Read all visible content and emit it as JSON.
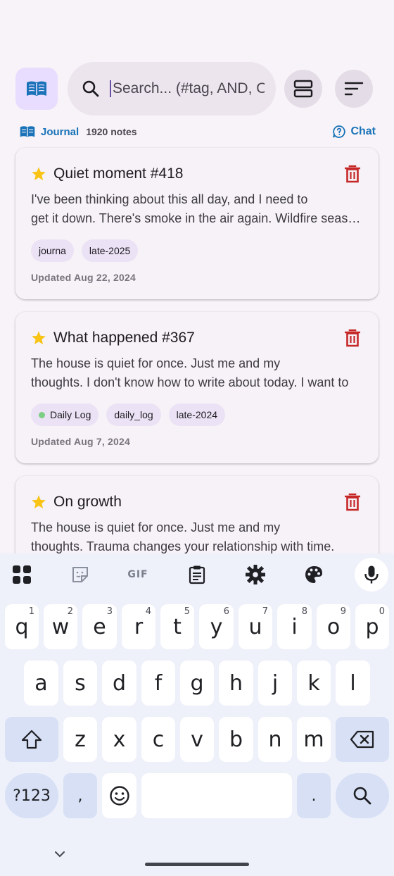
{
  "header": {
    "search_placeholder": "Search... (#tag, AND, OR)",
    "journal_label": "Journal",
    "notes_count": "1920 notes",
    "chat_label": "Chat"
  },
  "notes": [
    {
      "title": "Quiet moment #418",
      "body_line1": "I've been thinking about this all day, and I need to",
      "body_line2": "get it down. There's smoke in the air again. Wildfire season is here.",
      "tags": [
        "journa",
        "late-2025"
      ],
      "updated": "Updated Aug 22, 2024"
    },
    {
      "title": "What happened #367",
      "body_line1": "The house is quiet for once. Just me and my",
      "body_line2": "thoughts. I don't know how to write about today. I want to",
      "tags": [
        "Daily Log",
        "daily_log",
        "late-2024"
      ],
      "updated": "Updated Aug 7, 2024"
    },
    {
      "title": "On growth",
      "body_line1": "The house is quiet for once. Just me and my",
      "body_line2": "thoughts. Trauma changes your relationship with time.",
      "tags": [],
      "updated": ""
    }
  ],
  "keyboard": {
    "toolbar_gif": "GIF",
    "row1": [
      {
        "k": "q",
        "h": "1"
      },
      {
        "k": "w",
        "h": "2"
      },
      {
        "k": "e",
        "h": "3"
      },
      {
        "k": "r",
        "h": "4"
      },
      {
        "k": "t",
        "h": "5"
      },
      {
        "k": "y",
        "h": "6"
      },
      {
        "k": "u",
        "h": "7"
      },
      {
        "k": "i",
        "h": "8"
      },
      {
        "k": "o",
        "h": "9"
      },
      {
        "k": "p",
        "h": "0"
      }
    ],
    "row2": [
      "a",
      "s",
      "d",
      "f",
      "g",
      "h",
      "j",
      "k",
      "l"
    ],
    "row3": [
      "z",
      "x",
      "c",
      "v",
      "b",
      "n",
      "m"
    ],
    "symbols": "?123",
    "comma": ",",
    "period": "."
  },
  "colors": {
    "accent": "#1a73b8",
    "star": "#f9c416",
    "delete": "#c62828",
    "tag_dot": "#7ccf84"
  }
}
